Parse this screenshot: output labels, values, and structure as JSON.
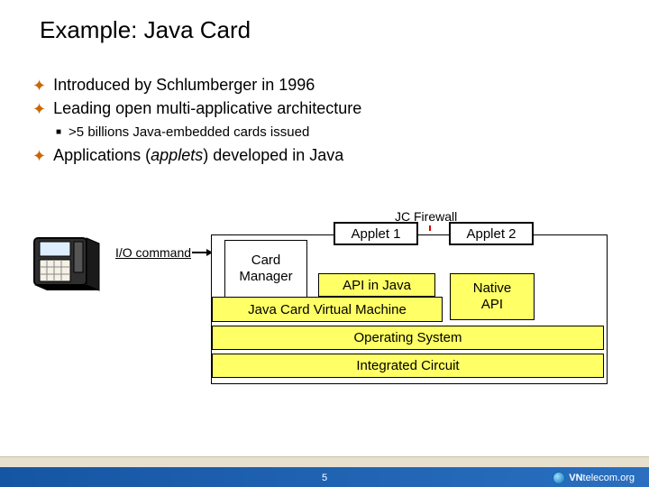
{
  "title": "Example: Java Card",
  "bullets": {
    "b1": "Introduced by Schlumberger in 1996",
    "b2": "Leading open multi-applicative architecture",
    "b2_sub": ">5 billions Java-embedded cards issued",
    "b3_prefix": "Applications (",
    "b3_em": "applets",
    "b3_suffix": ") developed in Java"
  },
  "diagram": {
    "jc_firewall": "JC Firewall",
    "io_command": "I/O command",
    "card_manager": "Card\nManager",
    "applet1": "Applet 1",
    "applet2": "Applet 2",
    "api_java": "API in Java",
    "native_api": "Native\nAPI",
    "jcvm": "Java Card Virtual Machine",
    "os": "Operating System",
    "ic": "Integrated Circuit"
  },
  "footer": {
    "page": "5",
    "logo_brand": "VN",
    "logo_rest": "telecom.org"
  }
}
